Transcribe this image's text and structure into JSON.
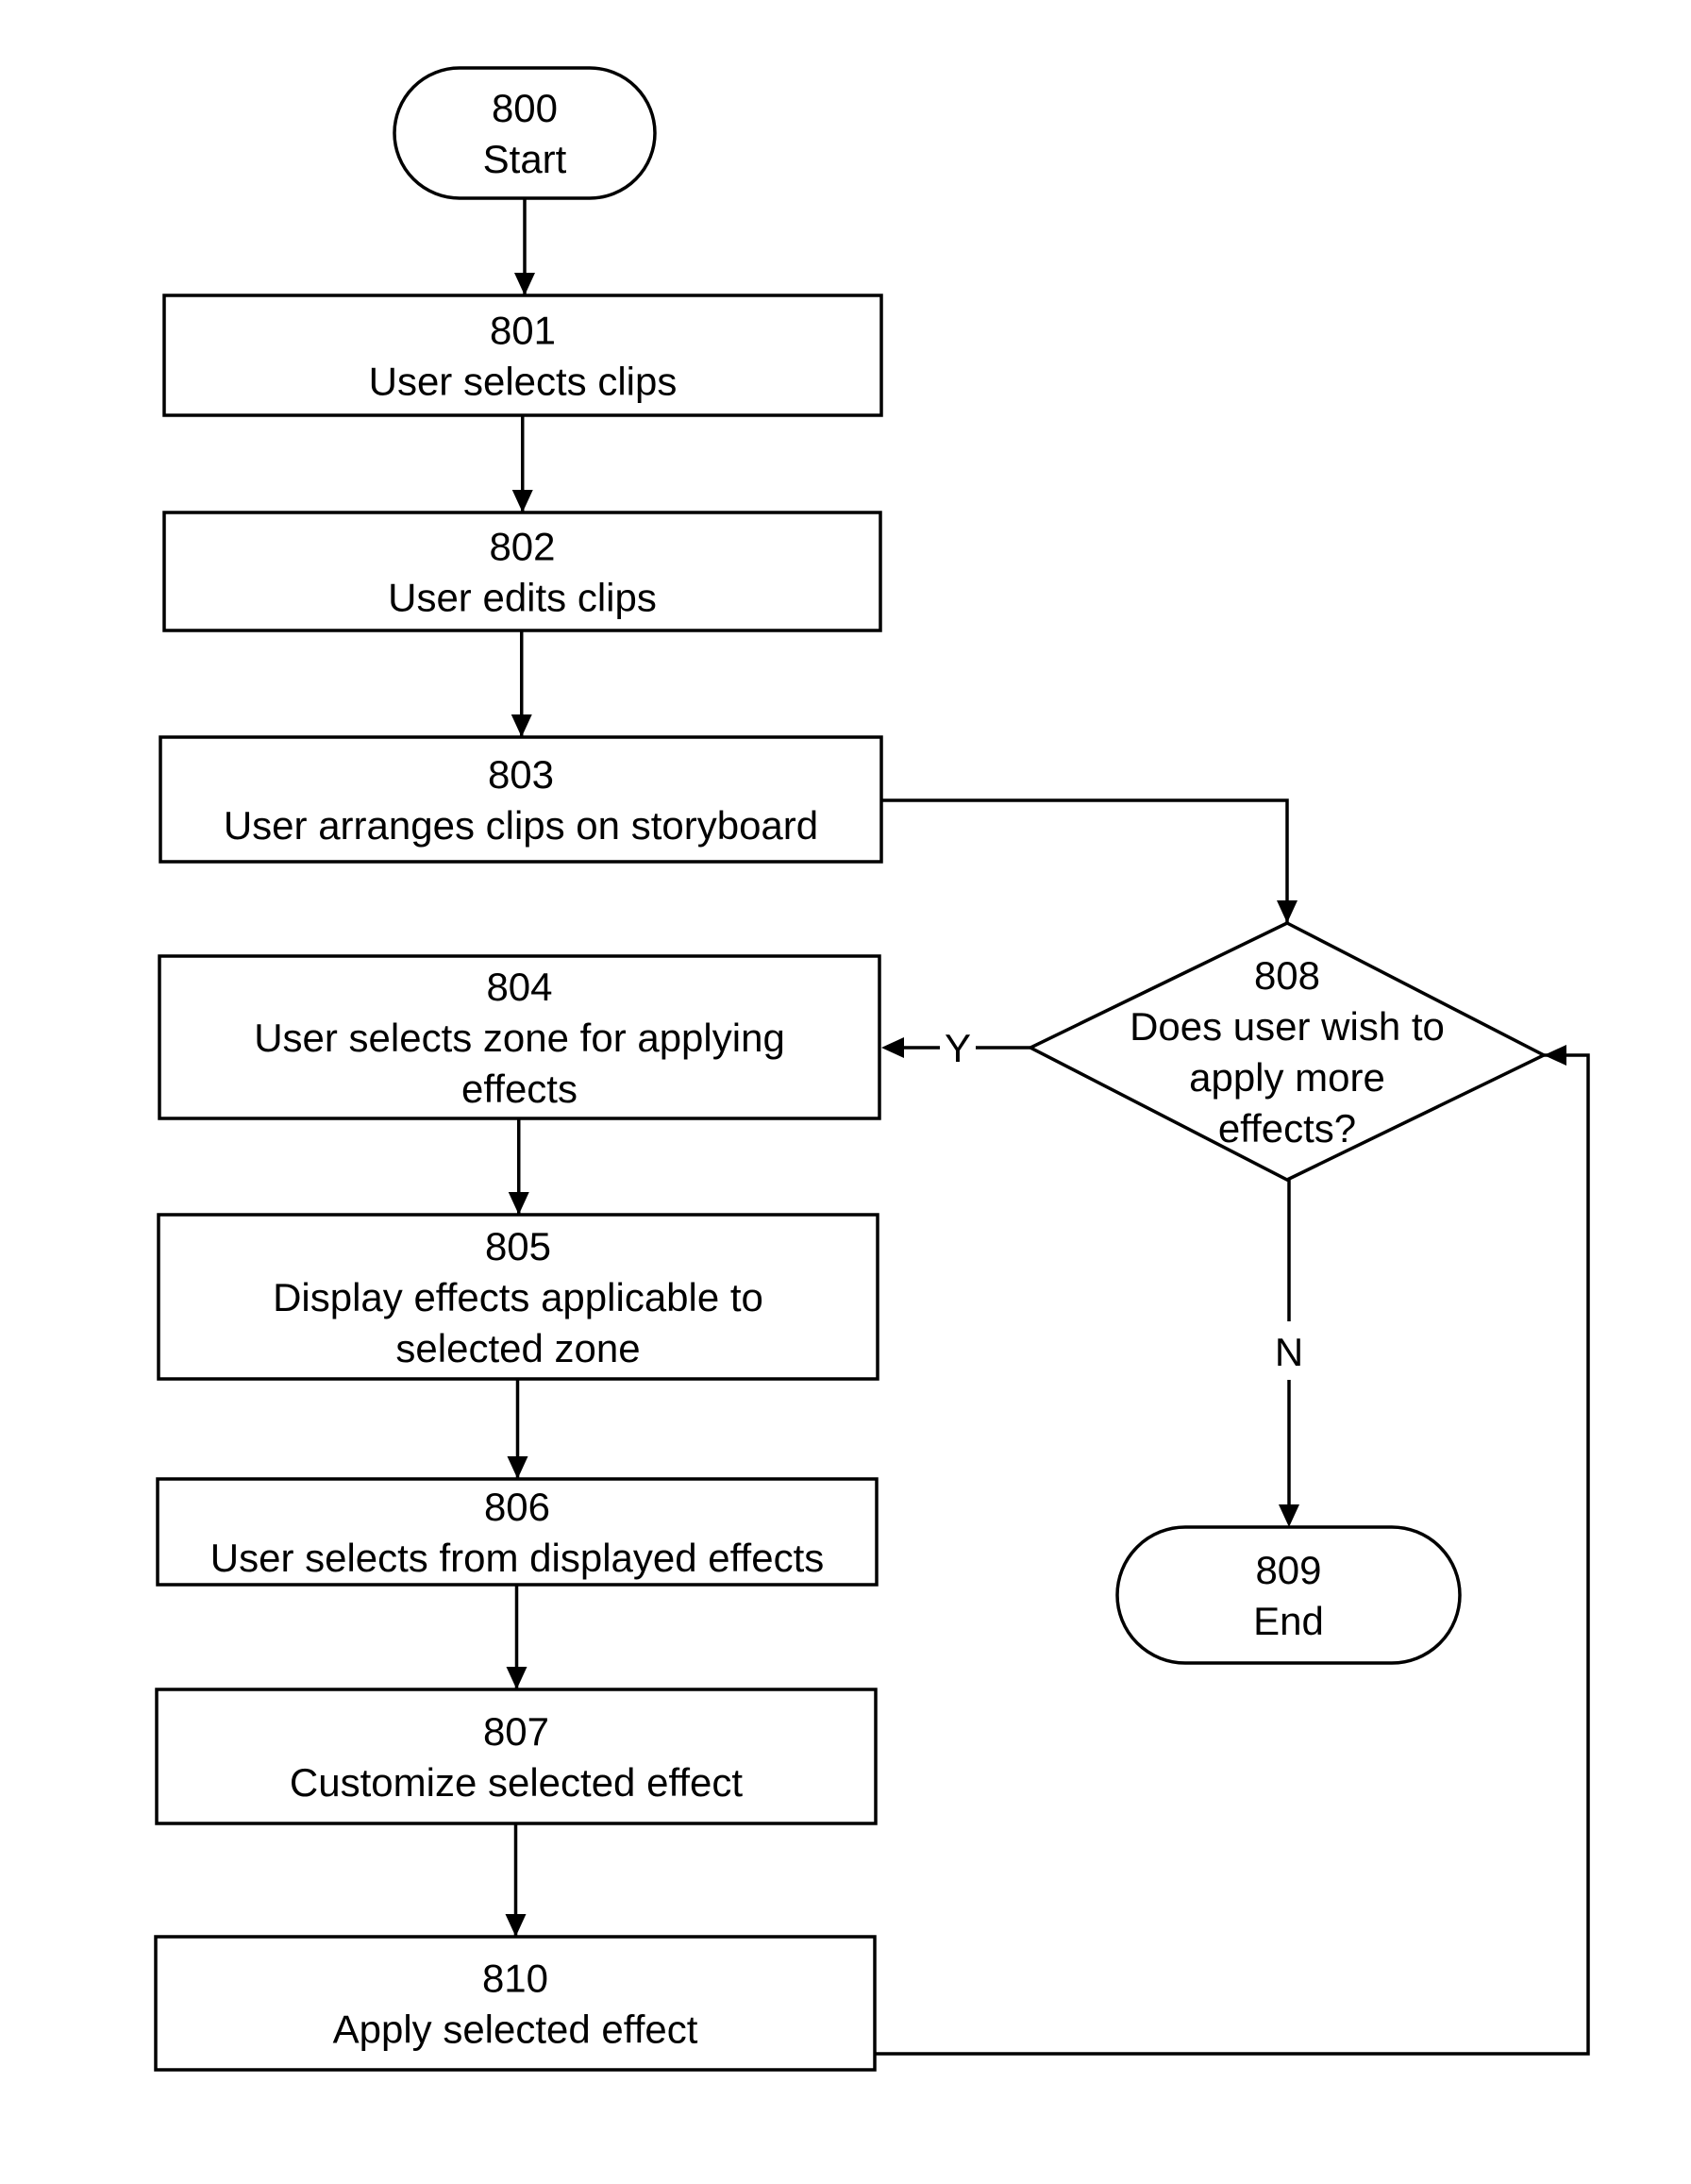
{
  "figure": {
    "type": "flowchart",
    "nodes": [
      {
        "id": "800",
        "shape": "terminator",
        "number": "800",
        "lines": [
          "Start"
        ]
      },
      {
        "id": "801",
        "shape": "process",
        "number": "801",
        "lines": [
          "User selects clips"
        ]
      },
      {
        "id": "802",
        "shape": "process",
        "number": "802",
        "lines": [
          "User edits clips"
        ]
      },
      {
        "id": "803",
        "shape": "process",
        "number": "803",
        "lines": [
          "User arranges clips on storyboard"
        ]
      },
      {
        "id": "804",
        "shape": "process",
        "number": "804",
        "lines": [
          "User selects zone for applying",
          "effects"
        ]
      },
      {
        "id": "805",
        "shape": "process",
        "number": "805",
        "lines": [
          "Display effects applicable to",
          "selected zone"
        ]
      },
      {
        "id": "806",
        "shape": "process",
        "number": "806",
        "lines": [
          "User selects from displayed effects"
        ]
      },
      {
        "id": "807",
        "shape": "process",
        "number": "807",
        "lines": [
          "Customize selected effect"
        ]
      },
      {
        "id": "810",
        "shape": "process",
        "number": "810",
        "lines": [
          "Apply selected effect"
        ]
      },
      {
        "id": "808",
        "shape": "decision",
        "number": "808",
        "lines": [
          "Does user wish to",
          "apply more",
          "effects?"
        ]
      },
      {
        "id": "809",
        "shape": "terminator",
        "number": "809",
        "lines": [
          "End"
        ]
      }
    ],
    "edges": [
      {
        "from": "800",
        "to": "801",
        "label": ""
      },
      {
        "from": "801",
        "to": "802",
        "label": ""
      },
      {
        "from": "802",
        "to": "803",
        "label": ""
      },
      {
        "from": "803",
        "to": "808",
        "label": ""
      },
      {
        "from": "808",
        "to": "804",
        "label": "Y"
      },
      {
        "from": "808",
        "to": "809",
        "label": "N"
      },
      {
        "from": "804",
        "to": "805",
        "label": ""
      },
      {
        "from": "805",
        "to": "806",
        "label": ""
      },
      {
        "from": "806",
        "to": "807",
        "label": ""
      },
      {
        "from": "807",
        "to": "810",
        "label": ""
      },
      {
        "from": "810",
        "to": "808",
        "label": ""
      }
    ]
  }
}
